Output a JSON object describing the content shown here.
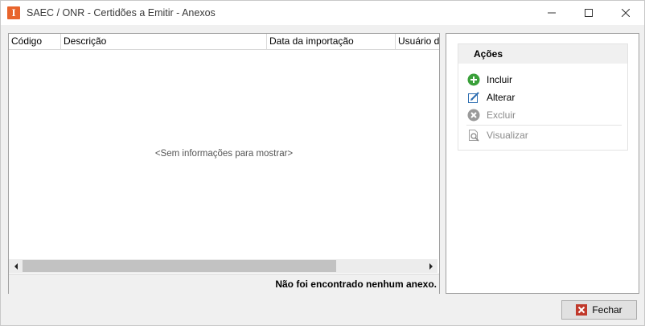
{
  "window": {
    "title": "SAEC / ONR - Certidões a Emitir - Anexos",
    "app_icon_letter": "I"
  },
  "grid": {
    "columns": [
      "Código",
      "Descrição",
      "Data da importação",
      "Usuário da"
    ],
    "empty_message": "<Sem informações para mostrar>",
    "footer_message": "Não foi encontrado nenhum anexo."
  },
  "actions": {
    "header": "Ações",
    "items": [
      {
        "label": "Incluir",
        "icon": "plus-circle-icon",
        "enabled": true
      },
      {
        "label": "Alterar",
        "icon": "edit-icon",
        "enabled": true
      },
      {
        "label": "Excluir",
        "icon": "x-circle-icon",
        "enabled": false
      },
      {
        "label": "Visualizar",
        "icon": "preview-icon",
        "enabled": false
      }
    ]
  },
  "buttons": {
    "fechar": "Fechar"
  },
  "colors": {
    "app_icon": "#e8642c",
    "add_green": "#3aa03a",
    "close_red": "#c0392b"
  }
}
